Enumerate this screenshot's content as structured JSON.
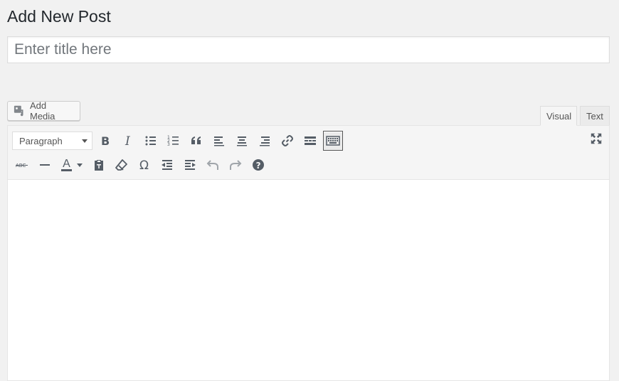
{
  "page": {
    "title": "Add New Post"
  },
  "title_field": {
    "placeholder": "Enter title here",
    "value": ""
  },
  "media": {
    "add_media_label": "Add Media"
  },
  "editor_tabs": {
    "visual": "Visual",
    "text": "Text"
  },
  "toolbar": {
    "format_select": "Paragraph",
    "row1": [
      "bold-icon",
      "italic-icon",
      "bulleted-list-icon",
      "numbered-list-icon",
      "blockquote-icon",
      "align-left-icon",
      "align-center-icon",
      "align-right-icon",
      "link-icon",
      "read-more-icon",
      "toolbar-toggle-icon"
    ],
    "row2": [
      "strikethrough-icon",
      "horizontal-line-icon",
      "text-color-icon",
      "paste-as-text-icon",
      "clear-formatting-icon",
      "special-character-icon",
      "decrease-indent-icon",
      "increase-indent-icon",
      "undo-icon",
      "redo-icon",
      "help-icon"
    ],
    "text_color_glyph": "A",
    "strike_glyph": "ABC",
    "omega_glyph": "Ω",
    "fullscreen": "fullscreen-icon"
  },
  "colors": {
    "background": "#f1f1f1",
    "icon": "#555d66",
    "disabled_icon": "#a0a5aa",
    "border": "#dddddd"
  }
}
